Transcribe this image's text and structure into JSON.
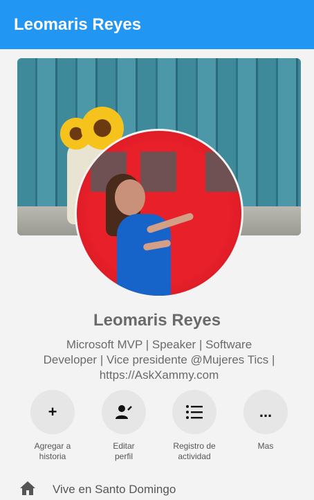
{
  "app_bar": {
    "title": "Leomaris Reyes",
    "color": "#2196f3"
  },
  "profile": {
    "name": "Leomaris Reyes",
    "bio_lines": [
      "Microsoft MVP | Speaker | Software",
      "Developer | Vice presidente @Mujeres Tics |",
      "https://AskXammy.com"
    ]
  },
  "actions": [
    {
      "icon": "plus-icon",
      "glyph": "+",
      "label_lines": [
        "Agregar a",
        "historia"
      ]
    },
    {
      "icon": "edit-profile-icon",
      "label_lines": [
        "Editar",
        "perfil"
      ]
    },
    {
      "icon": "list-icon",
      "label_lines": [
        "Registro de",
        "actividad"
      ]
    },
    {
      "icon": "more-icon",
      "glyph": "...",
      "label_lines": [
        "Mas"
      ]
    }
  ],
  "info": {
    "icon": "home-icon",
    "text": "Vive en Santo Domingo"
  }
}
